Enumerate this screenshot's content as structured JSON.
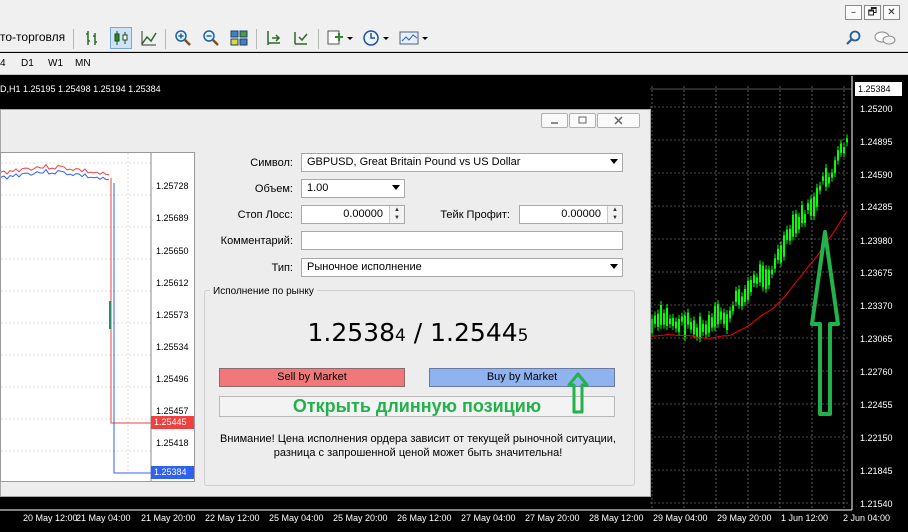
{
  "toolbar": {
    "autotrading_label": "то-торговля",
    "icons": [
      "bar-chart-icon",
      "candlestick-icon",
      "line-chart-icon",
      "zoom-in-icon",
      "zoom-out-icon",
      "tile-windows-icon",
      "autoscroll-icon",
      "chart-shift-icon",
      "indicators-icon",
      "periods-icon",
      "templates-icon",
      "search-icon",
      "chat-icon"
    ]
  },
  "window_controls": [
    "–",
    "🗗",
    "✕"
  ],
  "timeframes": [
    "4",
    "D1",
    "W1",
    "MN"
  ],
  "chart": {
    "header": "D,H1  1.25195 1.25498 1.25194 1.25384",
    "current_price": "1.25384",
    "price_labels": [
      "1.25200",
      "1.24895",
      "1.24590",
      "1.24285",
      "1.23980",
      "1.23675",
      "1.23370",
      "1.23065",
      "1.22760",
      "1.22455",
      "1.22150",
      "1.21845",
      "1.21540"
    ],
    "time_labels": [
      "20 May 12:00",
      "21 May 04:00",
      "21 May 20:00",
      "22 May 12:00",
      "25 May 04:00",
      "25 May 20:00",
      "26 May 12:00",
      "27 May 04:00",
      "27 May 20:00",
      "28 May 12:00",
      "29 May 04:00",
      "29 May 20:00",
      "1 Jun 12:00",
      "2 Jun 04:00"
    ],
    "colors": {
      "candles": "#00ff00",
      "ma": "#ff0000",
      "grid": "#9a9a9a",
      "arrow": "#22b24c"
    }
  },
  "dialog": {
    "mini_chart": {
      "price_labels": [
        "1.25728",
        "1.25689",
        "1.25650",
        "1.25612",
        "1.25573",
        "1.25534",
        "1.25496",
        "1.25457",
        "1.25418"
      ],
      "bid_tag": "1.25445",
      "ask_tag": "1.25384",
      "colors": {
        "bid": "#f04040",
        "ask": "#3060f0"
      }
    },
    "fields": {
      "symbol_label": "Символ:",
      "symbol_value": "GBPUSD, Great Britain Pound vs US Dollar",
      "volume_label": "Объем:",
      "volume_value": "1.00",
      "sl_label": "Стоп Лосс:",
      "sl_value": "0.00000",
      "tp_label": "Тейк Профит:",
      "tp_value": "0.00000",
      "comment_label": "Комментарий:",
      "comment_value": "",
      "type_label": "Тип:",
      "type_value": "Рыночное исполнение"
    },
    "market": {
      "group_title": "Исполнение по рынку",
      "bid_main": "1.2538",
      "bid_last": "4",
      "separator": " / ",
      "ask_main": "1.2544",
      "ask_last": "5",
      "sell_label": "Sell by Market",
      "buy_label": "Buy by Market",
      "open_long_label": "Открыть длинную позицию",
      "warning_line1": "Внимание! Цена исполнения ордера зависит от текущей рыночной ситуации,",
      "warning_line2": "разница с запрошенной ценой может быть значительна!"
    }
  }
}
